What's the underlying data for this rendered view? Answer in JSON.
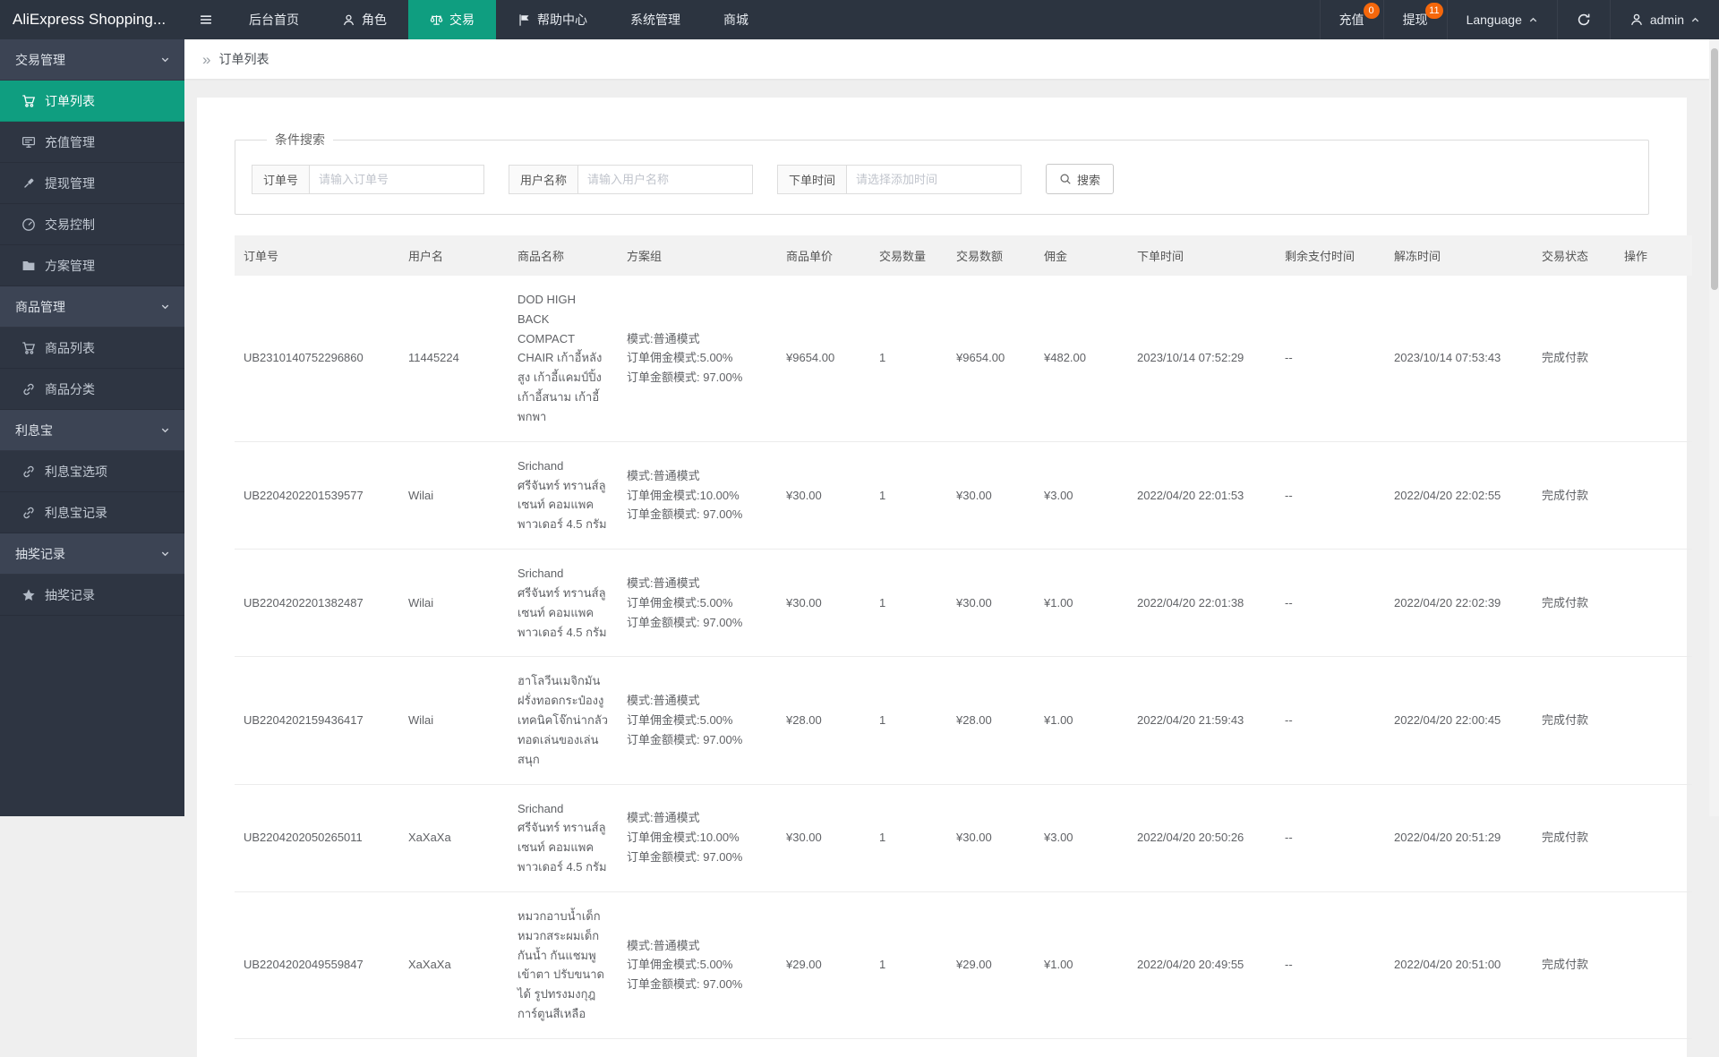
{
  "colors": {
    "accent": "#0f9e80",
    "badge": "#f5670b",
    "navbar_bg": "#2c3440",
    "sidebar_bg": "#2e3542"
  },
  "app": {
    "title": "AliExpress Shopping..."
  },
  "navbar": {
    "items": [
      {
        "label": "后台首页",
        "icon": null,
        "active": false
      },
      {
        "label": "角色",
        "icon": "user",
        "active": false
      },
      {
        "label": "交易",
        "icon": "scale",
        "active": true
      },
      {
        "label": "帮助中心",
        "icon": "flag",
        "active": false
      },
      {
        "label": "系统管理",
        "icon": null,
        "active": false
      },
      {
        "label": "商城",
        "icon": null,
        "active": false
      }
    ],
    "right": {
      "recharge": {
        "label": "充值",
        "badge": "0"
      },
      "withdraw": {
        "label": "提现",
        "badge": "11"
      },
      "language": {
        "label": "Language"
      },
      "admin": {
        "label": "admin"
      }
    }
  },
  "sidebar": {
    "sections": [
      {
        "title": "交易管理",
        "items": [
          {
            "label": "订单列表",
            "icon": "cart",
            "active": true
          },
          {
            "label": "充值管理",
            "icon": "card",
            "active": false
          },
          {
            "label": "提现管理",
            "icon": "gavel",
            "active": false
          },
          {
            "label": "交易控制",
            "icon": "gauge",
            "active": false
          },
          {
            "label": "方案管理",
            "icon": "folder",
            "active": false
          }
        ]
      },
      {
        "title": "商品管理",
        "items": [
          {
            "label": "商品列表",
            "icon": "cart",
            "active": false
          },
          {
            "label": "商品分类",
            "icon": "link",
            "active": false
          }
        ]
      },
      {
        "title": "利息宝",
        "items": [
          {
            "label": "利息宝选项",
            "icon": "link",
            "active": false
          },
          {
            "label": "利息宝记录",
            "icon": "link",
            "active": false
          }
        ]
      },
      {
        "title": "抽奖记录",
        "items": [
          {
            "label": "抽奖记录",
            "icon": "star",
            "active": false
          }
        ]
      }
    ]
  },
  "breadcrumb": {
    "title": "订单列表"
  },
  "search": {
    "legend": "条件搜索",
    "fields": [
      {
        "label": "订单号",
        "placeholder": "请输入订单号"
      },
      {
        "label": "用户名称",
        "placeholder": "请输入用户名称"
      },
      {
        "label": "下单时间",
        "placeholder": "请选择添加时间"
      }
    ],
    "button": "搜索"
  },
  "table": {
    "columns": [
      "订单号",
      "用户名",
      "商品名称",
      "方案组",
      "商品单价",
      "交易数量",
      "交易数额",
      "佣金",
      "下单时间",
      "剩余支付时间",
      "解冻时间",
      "交易状态",
      "操作"
    ],
    "rows": [
      [
        "UB2310140752296860",
        "11445224",
        "DOD HIGH BACK COMPACT CHAIR เก้าอี้หลังสูง เก้าอี้แคมป์ปิ้ง เก้าอี้สนาม เก้าอี้พกพา",
        [
          "模式:普通模式",
          "订单佣金模式:5.00%",
          "订单金额模式: 97.00%"
        ],
        "¥9654.00",
        "1",
        "¥9654.00",
        "¥482.00",
        "2023/10/14 07:52:29",
        "--",
        "2023/10/14 07:53:43",
        "完成付款",
        ""
      ],
      [
        "UB2204202201539577",
        "Wilai",
        "Srichand ศรีจันทร์ ทรานส์ลูเซนท์ คอมแพค พาวเดอร์ 4.5 กรัม",
        [
          "模式:普通模式",
          "订单佣金模式:10.00%",
          "订单金额模式: 97.00%"
        ],
        "¥30.00",
        "1",
        "¥30.00",
        "¥3.00",
        "2022/04/20 22:01:53",
        "--",
        "2022/04/20 22:02:55",
        "完成付款",
        ""
      ],
      [
        "UB2204202201382487",
        "Wilai",
        "Srichand ศรีจันทร์ ทรานส์ลูเซนท์ คอมแพค พาวเดอร์ 4.5 กรัม",
        [
          "模式:普通模式",
          "订单佣金模式:5.00%",
          "订单金额模式: 97.00%"
        ],
        "¥30.00",
        "1",
        "¥30.00",
        "¥1.00",
        "2022/04/20 22:01:38",
        "--",
        "2022/04/20 22:02:39",
        "完成付款",
        ""
      ],
      [
        "UB2204202159436417",
        "Wilai",
        "ฮาโลวีนเมจิกมันฝรั่งทอดกระป๋องงู เทคนิคโจ๊กน่ากลัว ทอดเล่นของเล่นสนุก",
        [
          "模式:普通模式",
          "订单佣金模式:5.00%",
          "订单金额模式: 97.00%"
        ],
        "¥28.00",
        "1",
        "¥28.00",
        "¥1.00",
        "2022/04/20 21:59:43",
        "--",
        "2022/04/20 22:00:45",
        "完成付款",
        ""
      ],
      [
        "UB2204202050265011",
        "XaXaXa",
        "Srichand ศรีจันทร์ ทรานส์ลูเซนท์ คอมแพค พาวเดอร์ 4.5 กรัม",
        [
          "模式:普通模式",
          "订单佣金模式:10.00%",
          "订单金额模式: 97.00%"
        ],
        "¥30.00",
        "1",
        "¥30.00",
        "¥3.00",
        "2022/04/20 20:50:26",
        "--",
        "2022/04/20 20:51:29",
        "完成付款",
        ""
      ],
      [
        "UB2204202049559847",
        "XaXaXa",
        "หมวกอาบน้ำเด็ก หมวกสระผมเด็ก กันน้ำ กันแชมพูเข้าตา ปรับขนาดได้ รูปทรงมงกุฎการ์ตูนสีเหลือ",
        [
          "模式:普通模式",
          "订单佣金模式:5.00%",
          "订单金额模式: 97.00%"
        ],
        "¥29.00",
        "1",
        "¥29.00",
        "¥1.00",
        "2022/04/20 20:49:55",
        "--",
        "2022/04/20 20:51:00",
        "完成付款",
        ""
      ]
    ]
  }
}
